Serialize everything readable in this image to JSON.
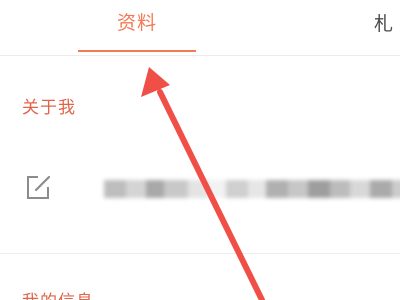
{
  "tabs": [
    {
      "label": "资料",
      "active": true
    },
    {
      "label": "札",
      "active": false
    }
  ],
  "about": {
    "heading": "关于我",
    "edit_icon": "edit-icon",
    "bio_text_redacted": true
  },
  "info": {
    "heading": "我的信息"
  },
  "annotation": {
    "icon": "red-arrow-icon"
  },
  "colors": {
    "accent": "#f27a55",
    "heading": "#e0634a",
    "annotation": "#f04f47",
    "divider": "#ececec"
  }
}
